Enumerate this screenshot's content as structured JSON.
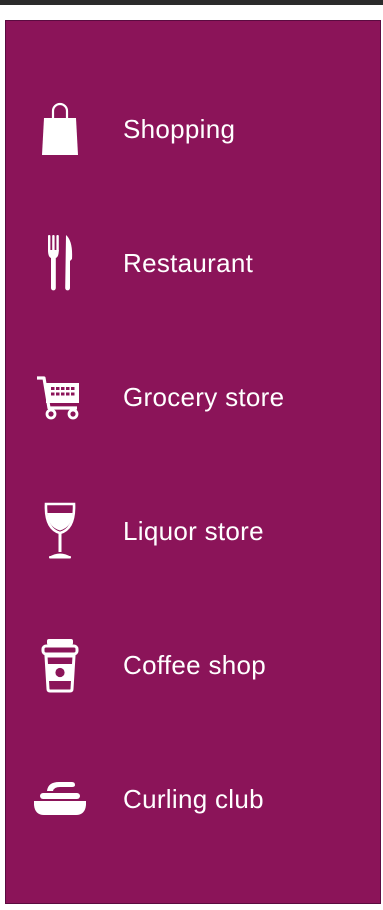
{
  "categories": [
    {
      "label": "Shopping",
      "icon": "shopping-bag-icon"
    },
    {
      "label": "Restaurant",
      "icon": "fork-knife-icon"
    },
    {
      "label": "Grocery store",
      "icon": "shopping-cart-icon"
    },
    {
      "label": "Liquor store",
      "icon": "wine-glass-icon"
    },
    {
      "label": "Coffee shop",
      "icon": "coffee-cup-icon"
    },
    {
      "label": "Curling club",
      "icon": "curling-stone-icon"
    }
  ],
  "colors": {
    "panel_background": "#8b1459",
    "text": "#ffffff",
    "icon": "#ffffff",
    "top_border": "#2b2b2b"
  }
}
